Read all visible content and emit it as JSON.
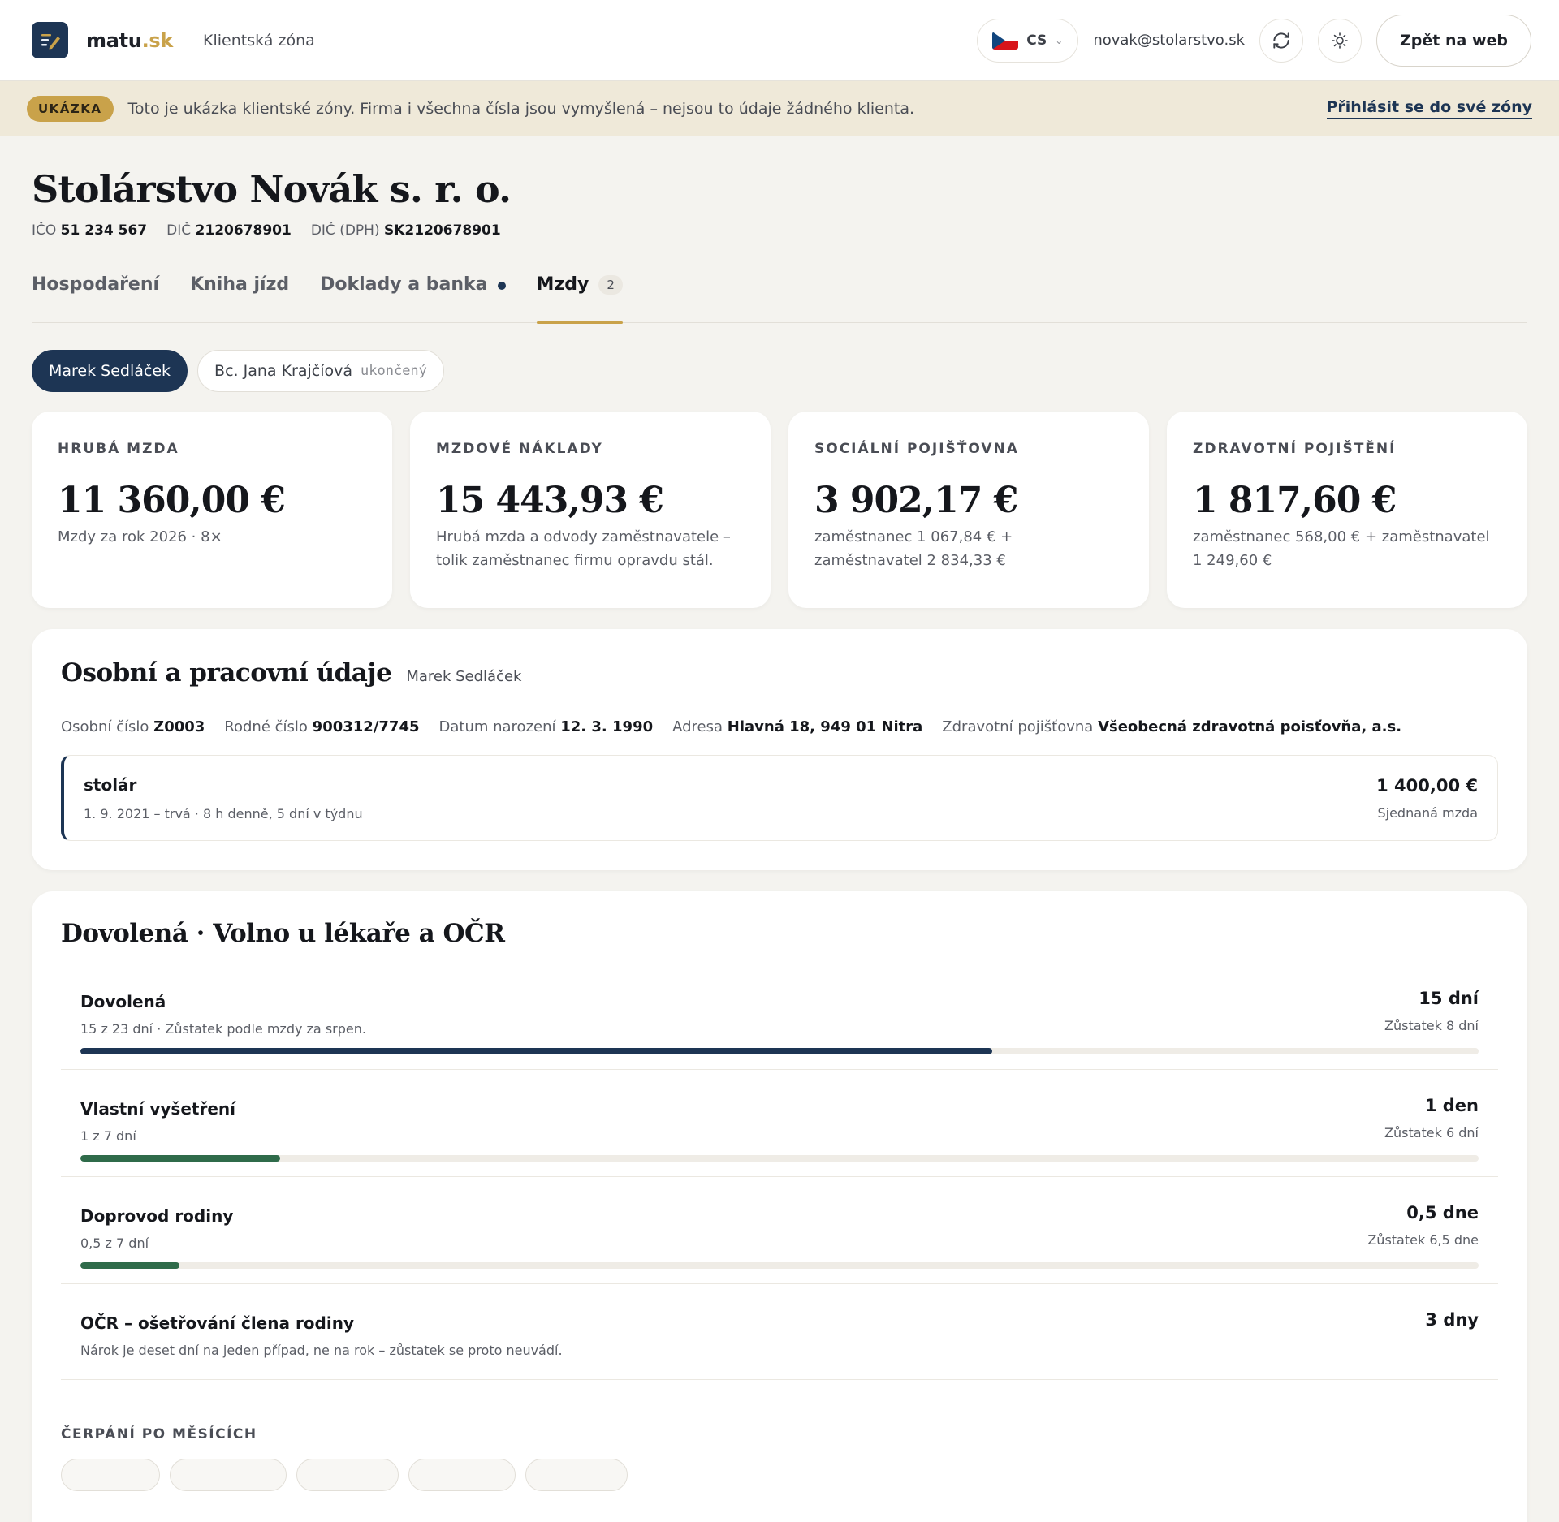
{
  "header": {
    "brand_name": "matu",
    "brand_tld": ".sk",
    "subtitle": "Klientská zóna",
    "lang_code": "CS",
    "user_email": "novak@stolarstvo.sk",
    "back_label": "Zpět na web"
  },
  "banner": {
    "badge": "UKÁZKA",
    "text": "Toto je ukázka klientské zóny. Firma i všechna čísla jsou vymyšlená – nejsou to údaje žádného klienta.",
    "link": "Přihlásit se do své zóny"
  },
  "company": {
    "name": "Stolárstvo Novák s. r. o.",
    "ico_label": "IČO",
    "ico": "51 234 567",
    "dic_label": "DIČ",
    "dic": "2120678901",
    "dph_label": "DIČ (DPH)",
    "dph": "SK2120678901"
  },
  "tabs": [
    {
      "label": "Hospodaření"
    },
    {
      "label": "Kniha jízd"
    },
    {
      "label": "Doklady a banka"
    },
    {
      "label": "Mzdy",
      "count": "2"
    }
  ],
  "people": [
    {
      "name": "Marek Sedláček"
    },
    {
      "name": "Bc. Jana Krajčíová",
      "status": "ukončený"
    }
  ],
  "stats": [
    {
      "label": "HRUBÁ MZDA",
      "value": "11 360,00 €",
      "desc": "Mzdy za rok 2026 · 8×"
    },
    {
      "label": "MZDOVÉ NÁKLADY",
      "value": "15 443,93 €",
      "desc": "Hrubá mzda a odvody zaměstnavatele – tolik zaměstnanec firmu opravdu stál."
    },
    {
      "label": "SOCIÁLNÍ POJIŠŤOVNA",
      "value": "3 902,17 €",
      "desc": "zaměstnanec 1 067,84 € + zaměstnavatel 2 834,33 €"
    },
    {
      "label": "ZDRAVOTNÍ POJIŠTĚNÍ",
      "value": "1 817,60 €",
      "desc": "zaměstnanec 568,00 € + zaměstnavatel 1 249,60 €"
    }
  ],
  "personal": {
    "title": "Osobní a pracovní údaje",
    "person": "Marek Sedláček",
    "facts": [
      {
        "label": "Osobní číslo",
        "value": "Z0003"
      },
      {
        "label": "Rodné číslo",
        "value": "900312/7745"
      },
      {
        "label": "Datum narození",
        "value": "12. 3. 1990"
      },
      {
        "label": "Adresa",
        "value": "Hlavná 18, 949 01 Nitra"
      },
      {
        "label": "Zdravotní pojišťovna",
        "value": "Všeobecná zdravotná poisťovňa, a.s."
      }
    ],
    "job": {
      "title": "stolár",
      "meta": "1. 9. 2021 – trvá · 8 h denně, 5 dní v týdnu",
      "salary": "1 400,00 €",
      "salary_label": "Sjednaná mzda"
    }
  },
  "leave": {
    "title": "Dovolená · Volno u lékaře a OČR",
    "rows": [
      {
        "name": "Dovolená",
        "desc": "15 z 23 dní · Zůstatek podle mzdy za srpen.",
        "amount": "15 dní",
        "rest": "Zůstatek 8 dní",
        "progress": 0.652,
        "color": "#1d3554"
      },
      {
        "name": "Vlastní vyšetření",
        "desc": "1 z 7 dní",
        "amount": "1 den",
        "rest": "Zůstatek 6 dní",
        "progress": 0.143,
        "color": "#2f6b4a"
      },
      {
        "name": "Doprovod rodiny",
        "desc": "0,5 z 7 dní",
        "amount": "0,5 dne",
        "rest": "Zůstatek 6,5 dne",
        "progress": 0.071,
        "color": "#2f6b4a"
      },
      {
        "name": "OČR – ošetřování člena rodiny",
        "desc": "Nárok je deset dní na jeden případ, ne na rok – zůstatek se proto neuvádí.",
        "amount": "3 dny",
        "rest": "",
        "progress": null,
        "color": ""
      }
    ],
    "monthly_label": "ČERPÁNÍ PO MĚSÍCÍCH"
  },
  "colors": {
    "accent": "#c9a24a",
    "navy": "#1d3554",
    "green": "#2f6b4a"
  }
}
